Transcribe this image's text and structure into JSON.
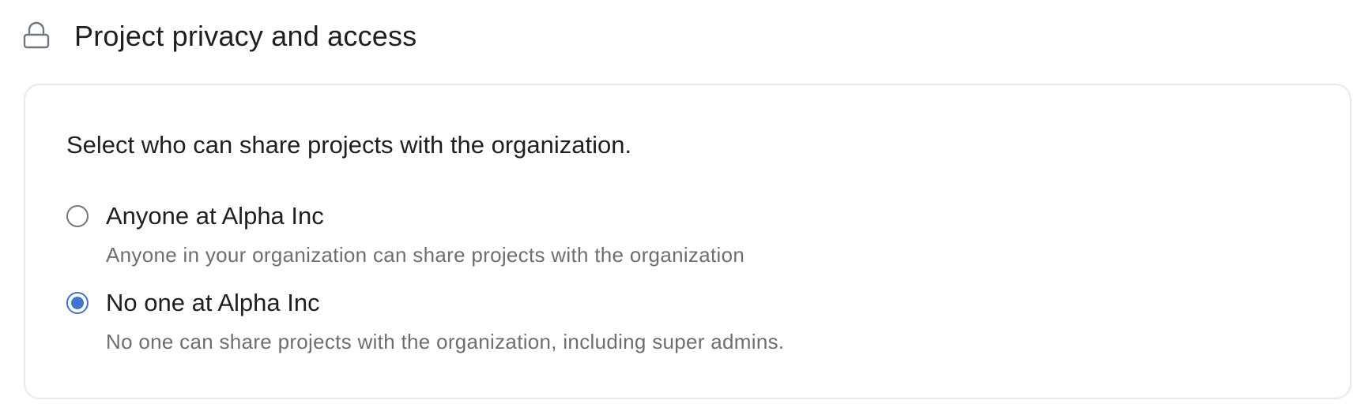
{
  "section": {
    "icon": "lock-icon",
    "title": "Project privacy and access"
  },
  "card": {
    "prompt": "Select who can share projects with the organization.",
    "options": [
      {
        "label": "Anyone at Alpha Inc",
        "description": "Anyone in your organization can share projects with the organization",
        "selected": false
      },
      {
        "label": "No one at Alpha Inc",
        "description": "No one can share projects with the organization, including super admins.",
        "selected": true
      }
    ]
  },
  "colors": {
    "accent": "#4573d2",
    "text_primary": "#1e1f21",
    "text_secondary": "#6d6e6f",
    "border": "#e8e8ea"
  }
}
